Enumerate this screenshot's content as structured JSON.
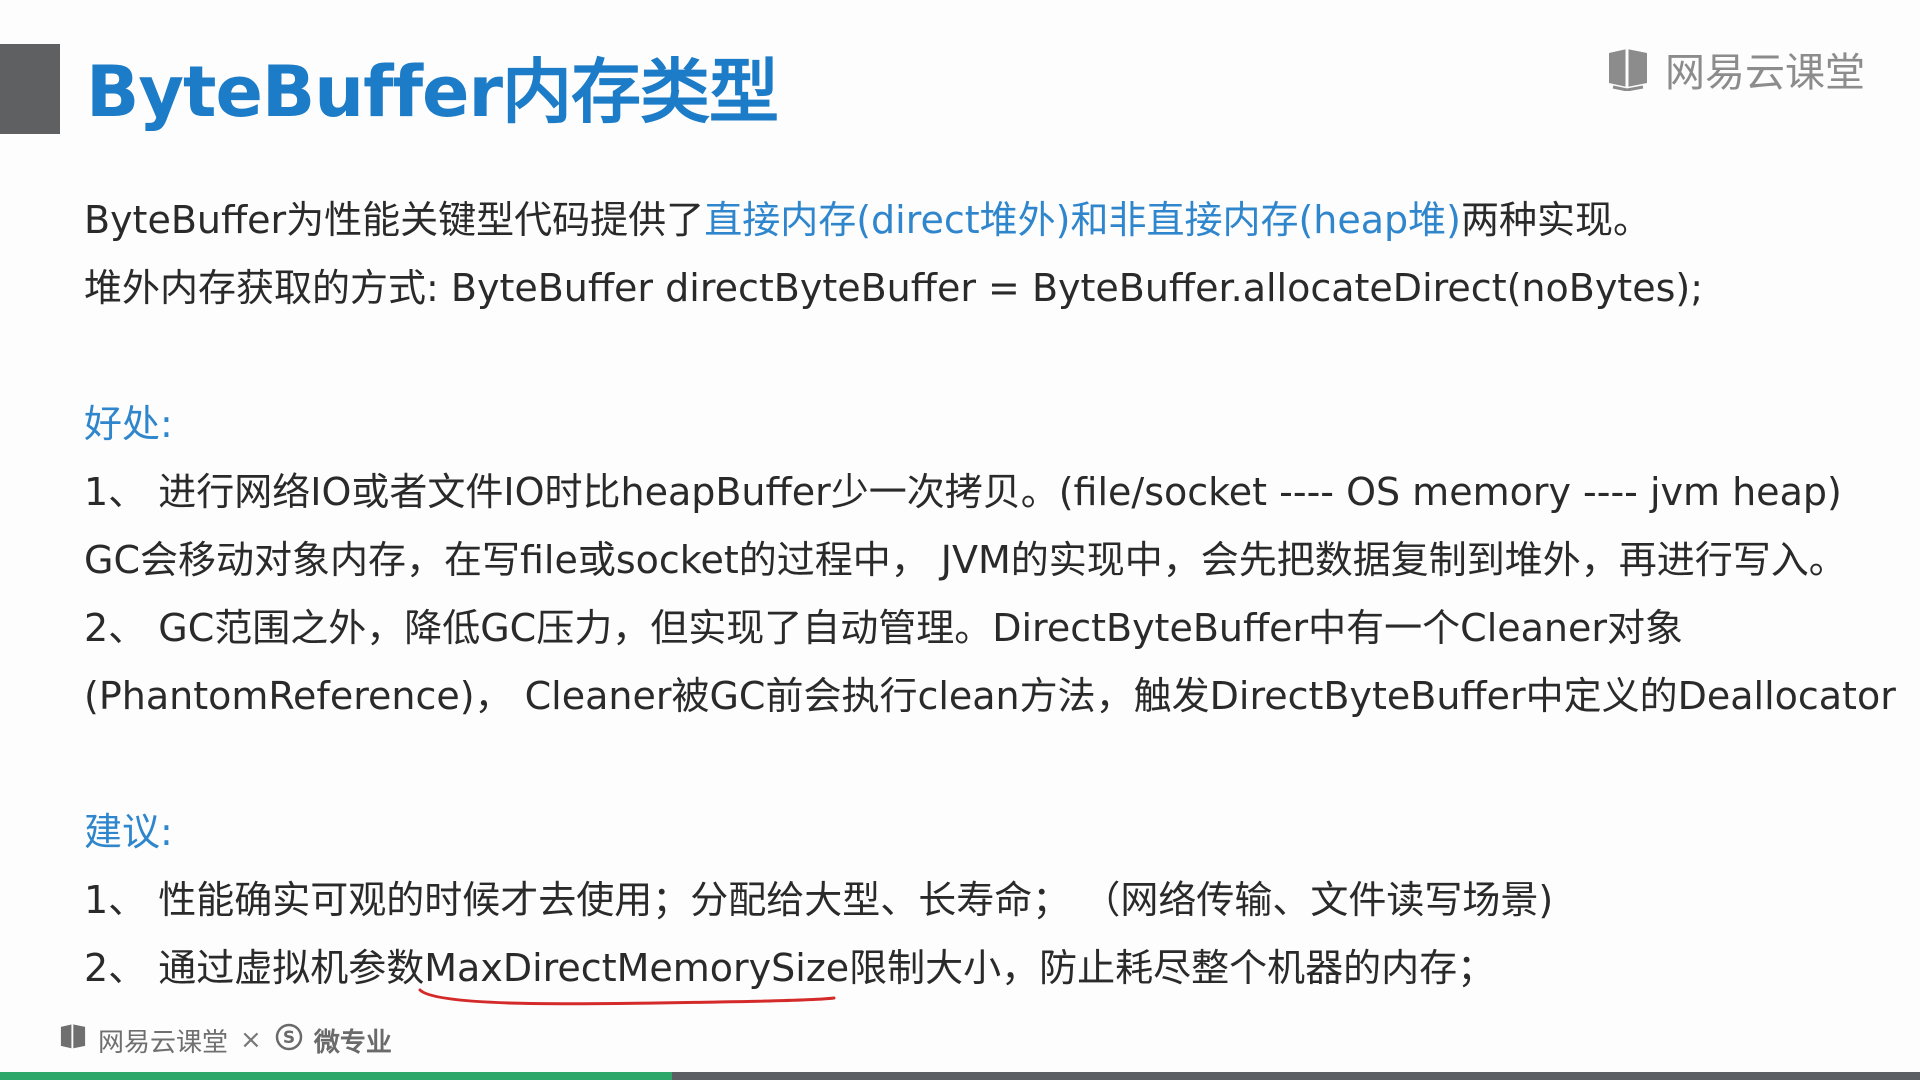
{
  "slide": {
    "title": "ByteBuffer内存类型",
    "brand": "网易云课堂",
    "lines": {
      "l1_a": "ByteBuffer为性能关键型代码提供了",
      "l1_b": "直接内存(direct堆外)和非直接内存(heap堆)",
      "l1_c": "两种实现。",
      "l2": "堆外内存获取的方式: ByteBuffer directByteBuffer = ByteBuffer.allocateDirect(noBytes);",
      "h1": "好处:",
      "b1": "1、 进行网络IO或者文件IO时比heapBuffer少一次拷贝。(file/socket  ---- OS memory  ---- jvm heap)",
      "b2": "GC会移动对象内存，在写file或socket的过程中， JVM的实现中，会先把数据复制到堆外，再进行写入。",
      "b3": "2、 GC范围之外，降低GC压力，但实现了自动管理。DirectByteBuffer中有一个Cleaner对象",
      "b4": "(PhantomReference)， Cleaner被GC前会执行clean方法，触发DirectByteBuffer中定义的Deallocator",
      "h2": "建议:",
      "s1": "1、 性能确实可观的时候才去使用；分配给大型、长寿命； （网络传输、文件读写场景)",
      "s2_a": "2、 通过虚拟机参数",
      "s2_b": "MaxDirectMemorySize",
      "s2_c": "限制大小，防止耗尽整个机器的内存；"
    }
  },
  "footer": {
    "brand": "网易云课堂",
    "separator": "×",
    "partner": "微专业"
  },
  "progress": {
    "fraction": 0.35,
    "played_color": "#2ea86a",
    "track_color": "#5b5e63"
  },
  "colors": {
    "title": "#1d7cc7",
    "highlight": "#2f86cc",
    "annotation": "#d42a2a"
  },
  "icons": {
    "brand": "book-icon",
    "partner": "s-circle-icon"
  }
}
